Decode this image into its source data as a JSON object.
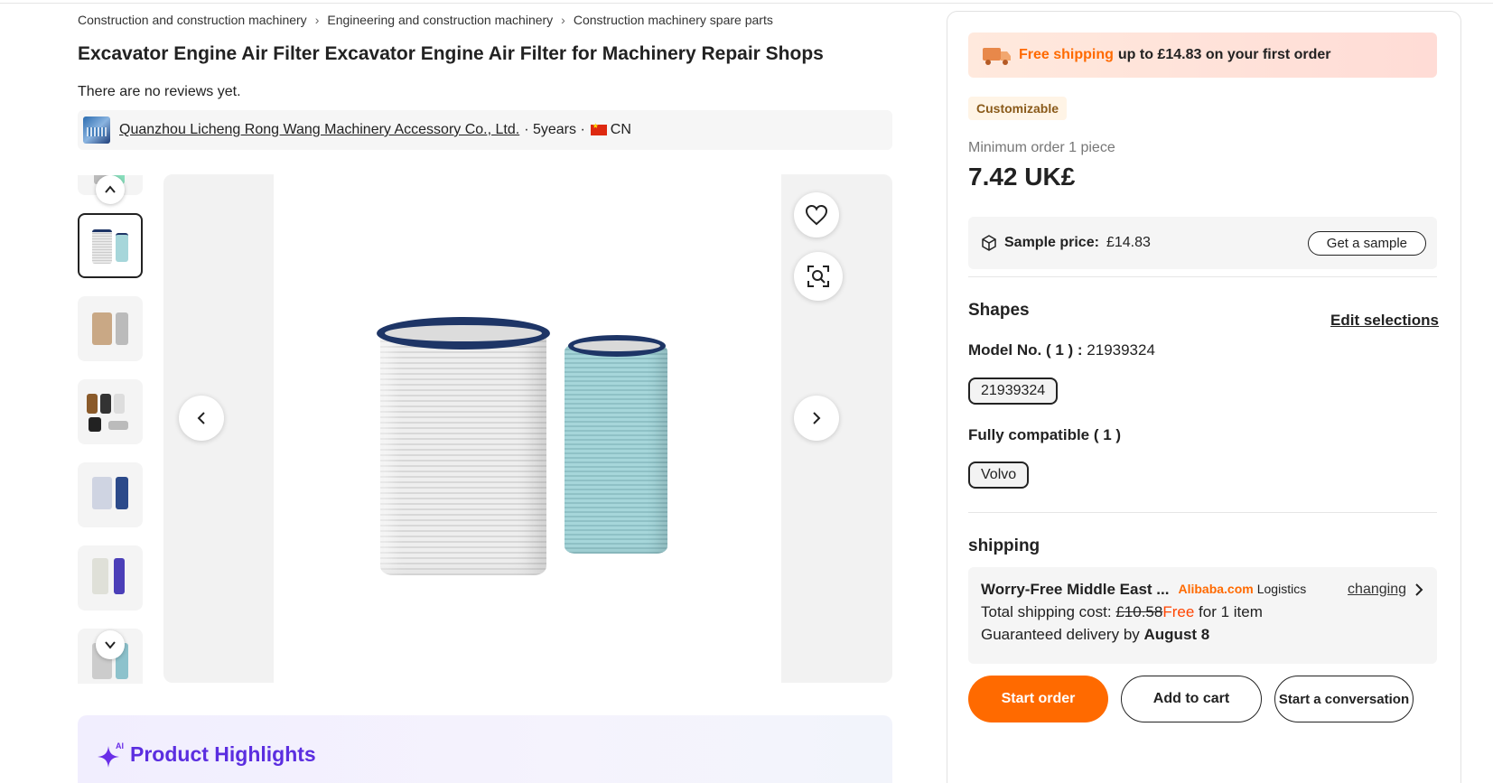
{
  "breadcrumb": [
    "Construction and construction machinery",
    "Engineering and construction machinery",
    "Construction machinery spare parts"
  ],
  "product": {
    "title": "Excavator Engine Air Filter Excavator Engine Air Filter for Machinery Repair Shops",
    "reviews": "There are no reviews yet."
  },
  "supplier": {
    "name": "Quanzhou Licheng Rong Wang Machinery Accessory Co., Ltd.",
    "years": "· 5years ·",
    "country": "CN"
  },
  "highlights": {
    "ai_badge": "AI",
    "title": "Product Highlights"
  },
  "panel": {
    "promo": {
      "free_shipping": "Free shipping",
      "rest": "up to £14.83 on your first order"
    },
    "badge": "Customizable",
    "min_order": "Minimum order 1 piece",
    "price": "7.42 UK£",
    "sample": {
      "label": "Sample price:",
      "value": "£14.83",
      "button": "Get a sample"
    },
    "shapes": {
      "title": "Shapes",
      "edit": "Edit selections",
      "model_label": "Model No. ( 1 ) :",
      "model_value": "21939324",
      "model_chip": "21939324",
      "compat_label": "Fully compatible ( 1 )",
      "compat_chip": "Volvo"
    },
    "shipping": {
      "title": "shipping",
      "service": "Worry-Free Middle East ...",
      "alibaba": "Alibaba.com",
      "logistics": "Logistics",
      "changing": "changing",
      "cost_label": "Total shipping cost:",
      "old_cost": "£10.58",
      "free": "Free",
      "for_item": "for 1 item",
      "delivery_label": "Guaranteed delivery by",
      "delivery_date": "August 8"
    },
    "buttons": {
      "start_order": "Start order",
      "add_to_cart": "Add to cart",
      "conversation": "Start a conversation"
    }
  },
  "colors": {
    "accent_orange": "#ff6a00",
    "highlight_purple": "#5b2ee0",
    "filter_navy": "#1e3566"
  }
}
